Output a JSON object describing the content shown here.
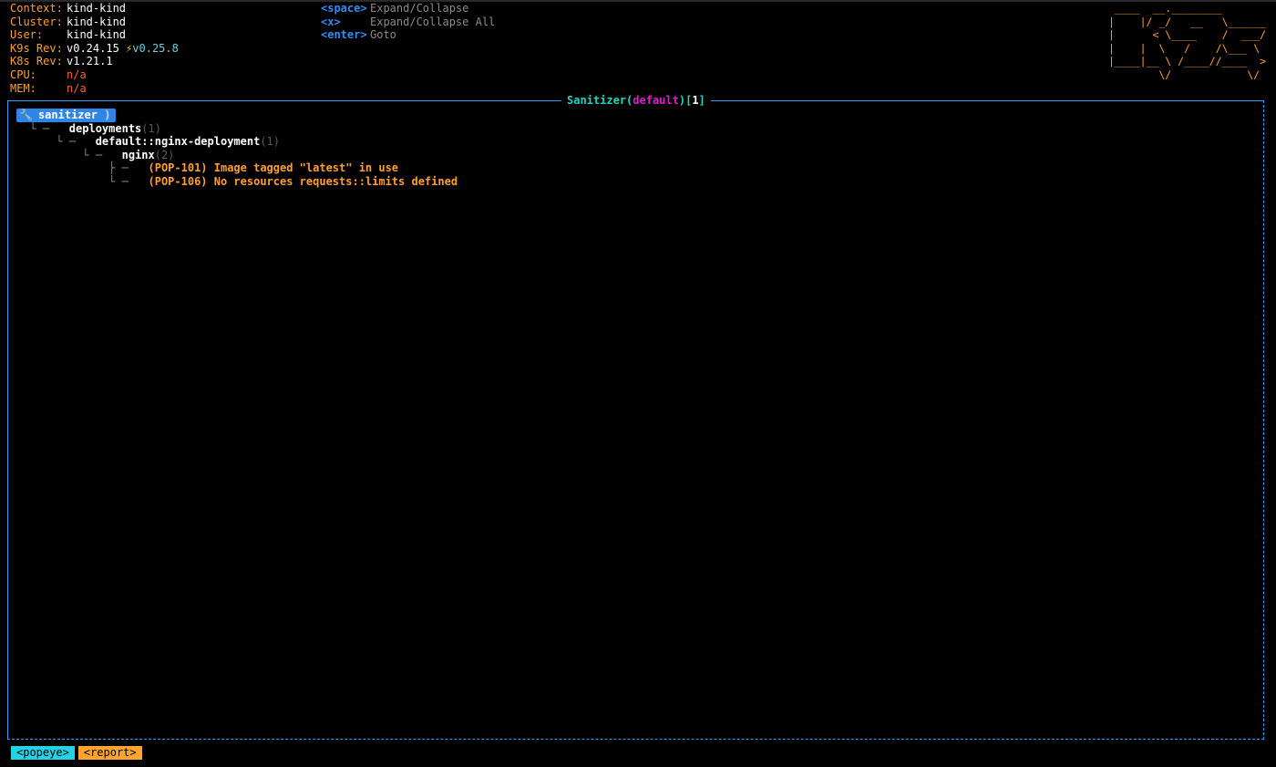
{
  "header": {
    "context_label": "Context:",
    "context_value": "kind-kind",
    "cluster_label": "Cluster:",
    "cluster_value": "kind-kind",
    "user_label": "User:",
    "user_value": "kind-kind",
    "k9s_label": "K9s Rev:",
    "k9s_value": "v0.24.15",
    "k9s_upgrade_icon": "lightning-bolt-icon",
    "k9s_new_version": "v0.25.8",
    "k8s_label": "K8s Rev:",
    "k8s_value": "v1.21.1",
    "cpu_label": "CPU:",
    "cpu_value": "n/a",
    "mem_label": "MEM:",
    "mem_value": "n/a"
  },
  "hints": [
    {
      "key": "<space>",
      "desc": "Expand/Collapse"
    },
    {
      "key": "<x>",
      "desc": "Expand/Collapse All"
    },
    {
      "key": "<enter>",
      "desc": "Goto"
    }
  ],
  "logo_text": " ____  __.________\n|    |/ _/   __   \\______\n|      < \\____    /  ___/\n|    |  \\   /    /\\___ \\\n|____|__ \\ /____//____  >\n        \\/            \\/",
  "panel": {
    "title_name": "Sanitizer",
    "title_ns": "default",
    "title_count": "1"
  },
  "tree": {
    "root_label": "sanitizer",
    "deployments_label": "deployments",
    "deployments_count": "(1)",
    "deployment_label": "default::nginx-deployment",
    "deployment_count": "(1)",
    "container_label": "nginx",
    "container_count": "(2)",
    "issues": [
      "(POP-101) Image tagged \"latest\" in use",
      "(POP-106) No resources requests::limits defined"
    ]
  },
  "crumbs": [
    {
      "label": "<popeye>",
      "color": "#22d3e6"
    },
    {
      "label": "<report>",
      "color": "#ffa52e"
    }
  ],
  "colors": {
    "accent": "#2ea1ff",
    "label": "#ff9f2e",
    "selection": "#2f86e8",
    "namespace": "#e21ecb",
    "title": "#22d3c4"
  }
}
